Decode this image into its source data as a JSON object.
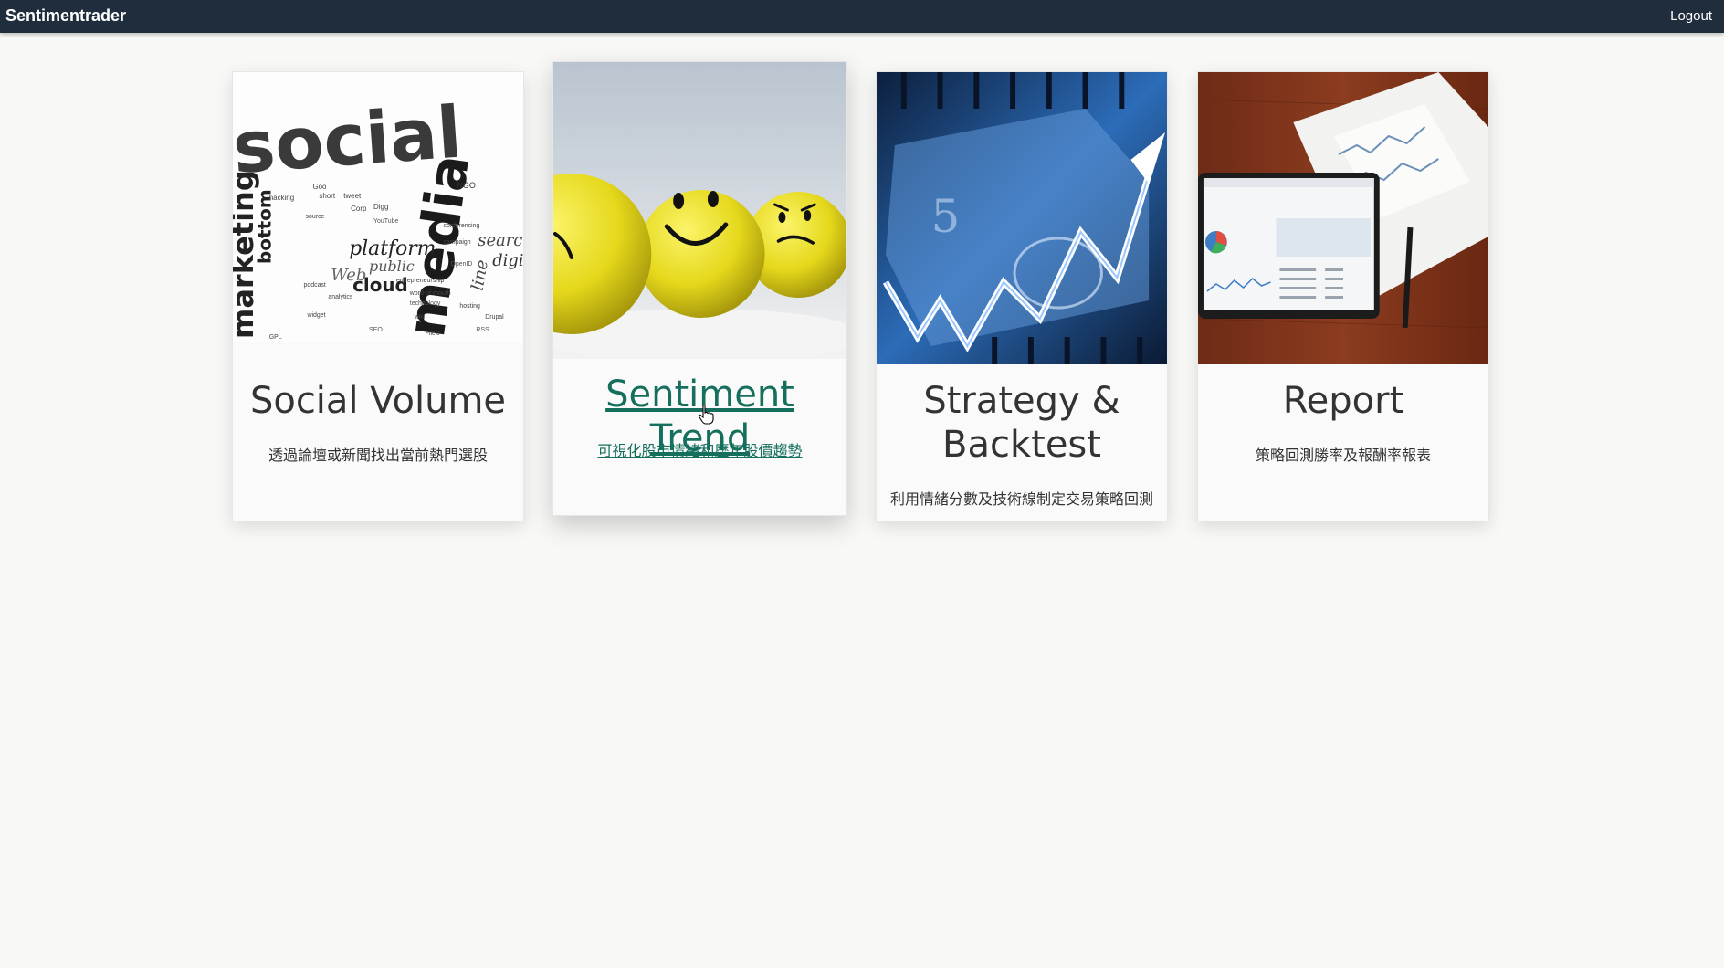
{
  "navbar": {
    "brand": "Sentimentrader",
    "logout_label": "Logout"
  },
  "cards": [
    {
      "title": "Social Volume",
      "description": "透過論壇或新聞找出當前熱門選股",
      "image": "social-media-word-cloud",
      "active": false
    },
    {
      "title": "Sentiment Trend",
      "description": "可視化股市情緒和歷年股價趨勢",
      "image": "emoji-balls",
      "active": true
    },
    {
      "title": "Strategy & Backtest",
      "description": "利用情緒分數及技術線制定交易策略回測",
      "image": "dollar-arrow-chart",
      "active": false
    },
    {
      "title": "Report",
      "description": "策略回測勝率及報酬率報表",
      "image": "tablet-report",
      "active": false
    }
  ],
  "word_cloud": {
    "big": [
      "social",
      "media",
      "marketing"
    ],
    "medium": [
      "platform",
      "cloud",
      "search",
      "public",
      "Web",
      "bottom",
      "digit",
      "line"
    ],
    "small": [
      "hacking",
      "short",
      "tweet",
      "Goo",
      "NGO",
      "Corp",
      "Digg",
      "YouTube",
      "conferencing",
      "podcast",
      "analytics",
      "entrepreneurship",
      "word-of-mouth",
      "technology",
      "widget",
      "hosting",
      "Drupal",
      "RSS",
      "GPL",
      "SEO",
      "wiki",
      "source",
      "campaign",
      "OpenID",
      "Flickr"
    ]
  },
  "colors": {
    "navbar": "#1f2d3d",
    "active_link": "#156f5d",
    "background": "#f8f8f6"
  }
}
